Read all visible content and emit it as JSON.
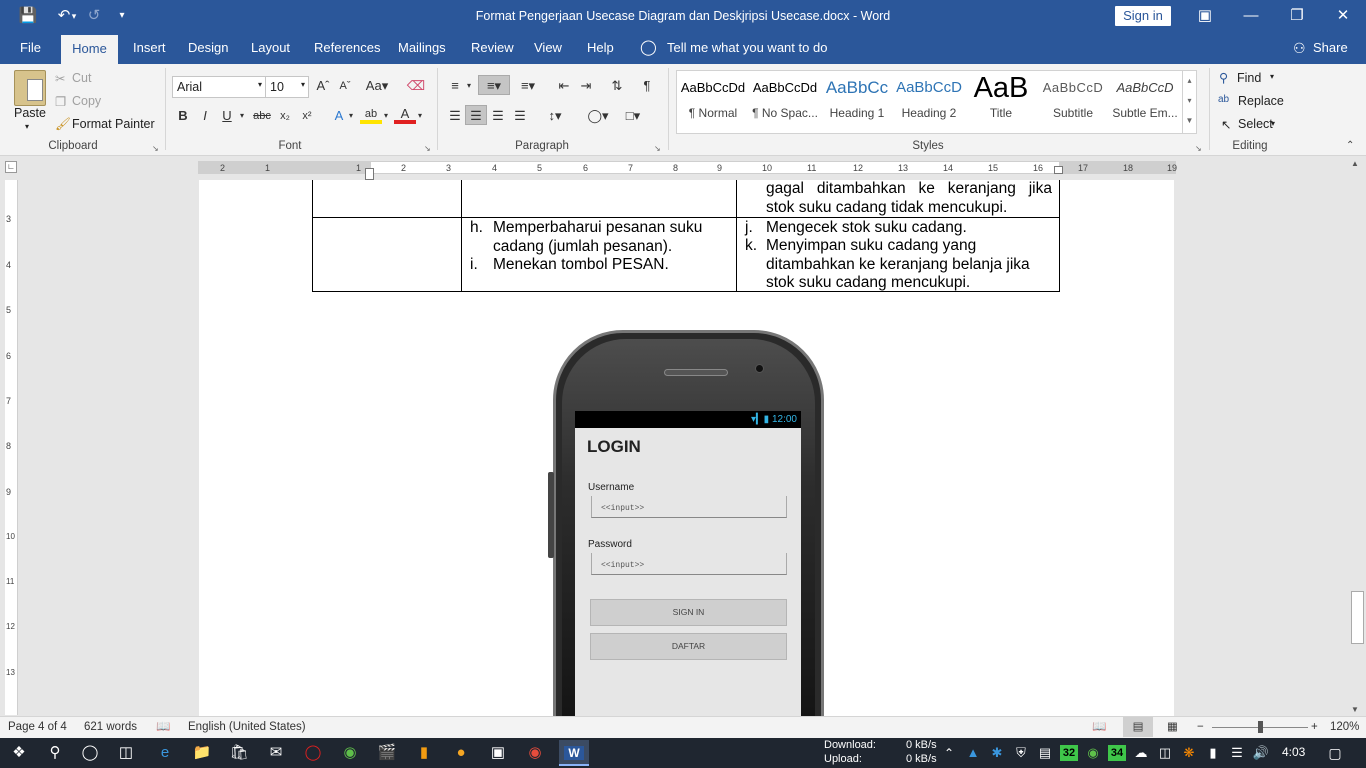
{
  "window": {
    "title": "Format Pengerjaan Usecase Diagram dan Deskjripsi Usecase.docx  -  Word",
    "sign_in": "Sign in",
    "controls": [
      "restore-ribbon",
      "minimize",
      "maximize",
      "close"
    ]
  },
  "tabs": [
    "File",
    "Home",
    "Insert",
    "Design",
    "Layout",
    "References",
    "Mailings",
    "Review",
    "View",
    "Help"
  ],
  "tell_me": "Tell me what you want to do",
  "share": "Share",
  "clipboard": {
    "paste": "Paste",
    "cut": "Cut",
    "copy": "Copy",
    "format_painter": "Format Painter",
    "label": "Clipboard"
  },
  "font": {
    "name": "Arial",
    "size": "10",
    "label": "Font",
    "case_label": "Aa"
  },
  "paragraph": {
    "label": "Paragraph"
  },
  "styles": {
    "label": "Styles",
    "items": [
      {
        "preview": "AaBbCcDd",
        "name": "¶ Normal"
      },
      {
        "preview": "AaBbCcDd",
        "name": "¶ No Spac..."
      },
      {
        "preview": "AaBbCc",
        "name": "Heading 1"
      },
      {
        "preview": "AaBbCcD",
        "name": "Heading 2"
      },
      {
        "preview": "AaB",
        "name": "Title"
      },
      {
        "preview": "AaBbCcD",
        "name": "Subtitle"
      },
      {
        "preview": "AaBbCcD",
        "name": "Subtle Em..."
      }
    ]
  },
  "editing": {
    "find": "Find",
    "replace": "Replace",
    "select": "Select",
    "label": "Editing"
  },
  "ruler": {
    "h_numbers": [
      "2",
      "1",
      "1",
      "2",
      "3",
      "4",
      "5",
      "6",
      "7",
      "8",
      "9",
      "10",
      "11",
      "12",
      "13",
      "14",
      "15",
      "16",
      "17",
      "18",
      "19"
    ],
    "v_numbers": [
      "3",
      "4",
      "5",
      "6",
      "7",
      "8",
      "9",
      "10",
      "11",
      "12",
      "13"
    ]
  },
  "table": {
    "prev_row_right_line1": "gagal ditambahkan ke keranjang jika",
    "prev_row_right_line2": "stok suku cadang tidak mencukupi.",
    "row_middle_items": [
      {
        "marker": "h.",
        "line1": "Memperbaharui pesanan suku",
        "line2": "cadang (jumlah pesanan)."
      },
      {
        "marker": "i.",
        "line1": "Menekan tombol PESAN.",
        "line2": ""
      }
    ],
    "row_right_items": [
      {
        "marker": "j.",
        "line1": "Mengecek stok suku cadang.",
        "line2": "",
        "line3": ""
      },
      {
        "marker": "k.",
        "line1": "Menyimpan suku cadang yang",
        "line2": "ditambahkan ke keranjang belanja jika",
        "line3": "stok suku cadang mencukupi."
      }
    ]
  },
  "phone": {
    "time": "12:00",
    "title": "LOGIN",
    "username_label": "Username",
    "username_placeholder": "<<input>>",
    "password_label": "Password",
    "password_placeholder": "<<input>>",
    "signin_button": "SIGN IN",
    "daftar_button": "DAFTAR"
  },
  "statusbar": {
    "page": "Page 4 of 4",
    "words": "621 words",
    "language": "English (United States)",
    "zoom": "120%"
  },
  "taskbar": {
    "download_label": "Download:",
    "download_value": "0 kB/s",
    "upload_label": "Upload:",
    "upload_value": "0 kB/s",
    "badge1": "32",
    "badge2": "34",
    "clock": "4:03"
  }
}
